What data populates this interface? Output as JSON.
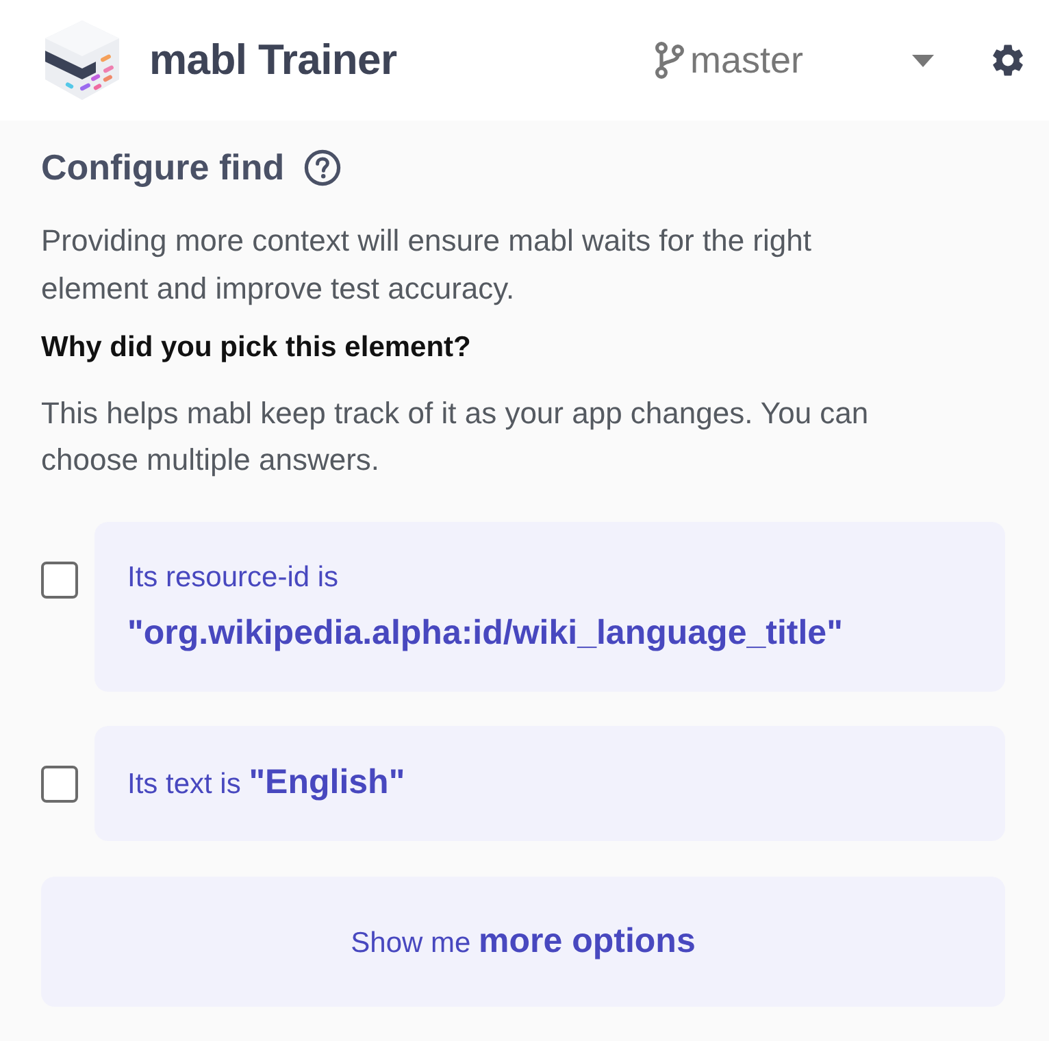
{
  "header": {
    "app_name": "mabl Trainer",
    "branch": "master"
  },
  "section": {
    "title": "Configure find",
    "intro": "Providing more context will ensure mabl waits for the right element and improve test accuracy.",
    "question": "Why did you pick this element?",
    "hint": "This helps mabl keep track of it as your app changes. You can choose multiple answers."
  },
  "options": [
    {
      "text": "Its resource-id is **\"org.wikipedia.alpha:id/wiki_language_title\"**",
      "checked": false
    },
    {
      "text": "Its text is **\"English\"**",
      "checked": false
    }
  ],
  "more_button": "Show me **more options**"
}
